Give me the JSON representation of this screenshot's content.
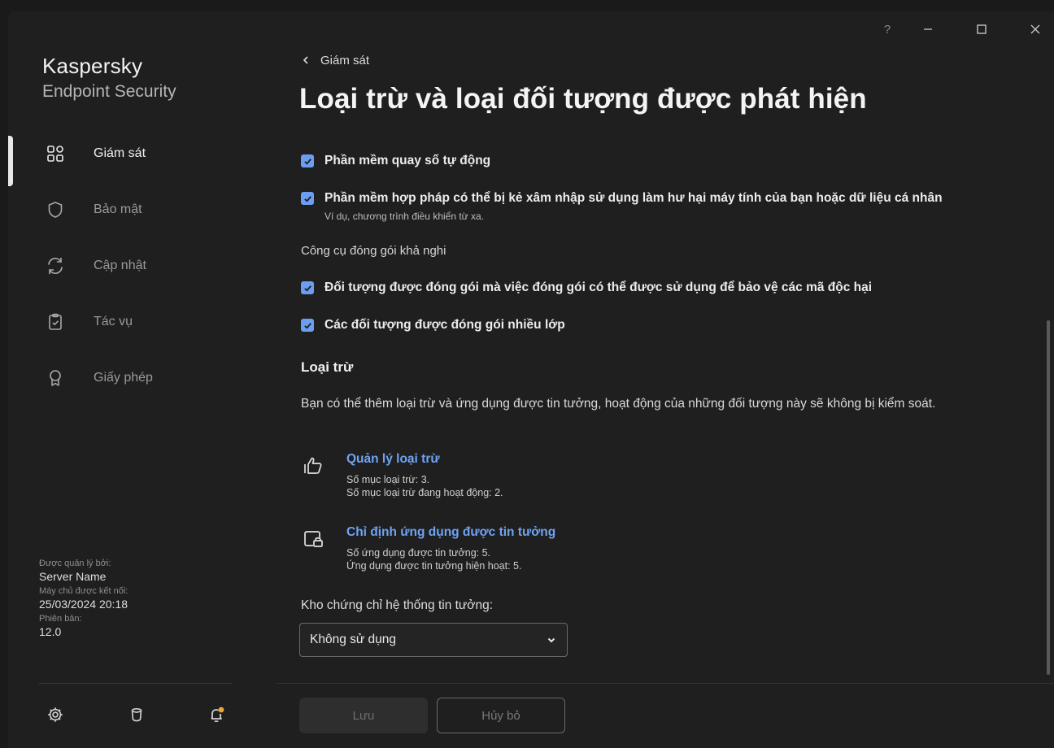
{
  "window": {
    "help": "?",
    "minimize": "–",
    "maximize": "☐",
    "close": "✕"
  },
  "brand": {
    "line1": "Kaspersky",
    "line2": "Endpoint Security"
  },
  "sidebar": {
    "items": [
      {
        "label": "Giám sát",
        "icon": "dashboard-icon",
        "active": true
      },
      {
        "label": "Bảo mật",
        "icon": "shield-icon",
        "active": false
      },
      {
        "label": "Cập nhật",
        "icon": "sync-icon",
        "active": false
      },
      {
        "label": "Tác vụ",
        "icon": "clipboard-check-icon",
        "active": false
      },
      {
        "label": "Giấy phép",
        "icon": "license-ribbon-icon",
        "active": false
      }
    ],
    "meta": {
      "managed_by_label": "Được quản lý bởi:",
      "managed_by_value": "Server Name",
      "connected_label": "Máy chủ được kết nối:",
      "connected_value": "25/03/2024 20:18",
      "version_label": "Phiên bản:",
      "version_value": "12.0"
    },
    "bottom_icons": [
      "settings-icon",
      "support-icon",
      "notifications-bell-icon"
    ]
  },
  "breadcrumb": {
    "back_label": "Giám sát"
  },
  "page": {
    "title": "Loại trừ và loại đối tượng được phát hiện"
  },
  "checkboxes": {
    "autodialer": {
      "label": "Phần mềm quay số tự động",
      "checked": true
    },
    "legit_software": {
      "label": "Phần mềm hợp pháp có thể bị kẻ xâm nhập sử dụng làm hư hại máy tính của bạn hoặc dữ liệu cá nhân",
      "sub": "Ví dụ, chương trình điều khiển từ xa.",
      "checked": true
    },
    "packed_objects": {
      "label": "Đối tượng được đóng gói mà việc đóng gói có thể được sử dụng để bảo vệ các mã độc hại",
      "checked": true
    },
    "multipacked": {
      "label": "Các đối tượng được đóng gói nhiều lớp",
      "checked": true
    }
  },
  "packers_section_label": "Công cụ đóng gói khả nghi",
  "exclusions": {
    "heading": "Loại trừ",
    "description": "Bạn có thể thêm loại trừ và ứng dụng được tin tưởng, hoạt động của những đối tượng này sẽ không bị kiểm soát.",
    "manage": {
      "title": "Quản lý loại trừ",
      "line1": "Số mục loại trừ: 3.",
      "line2": "Số mục loại trừ đang hoạt động: 2."
    },
    "trusted": {
      "title": "Chỉ định ứng dụng được tin tưởng",
      "line1": "Số ứng dụng được tin tưởng: 5.",
      "line2": "Ứng dụng được tin tưởng hiện hoạt: 5."
    }
  },
  "cert_store": {
    "label": "Kho chứng chỉ hệ thống tin tưởng:",
    "selected": "Không sử dụng"
  },
  "footer": {
    "save_label": "Lưu",
    "cancel_label": "Hủy bỏ"
  },
  "colors": {
    "accent": "#6b9ef0",
    "link": "#6fa3f5",
    "notification_dot": "#f0a830"
  }
}
